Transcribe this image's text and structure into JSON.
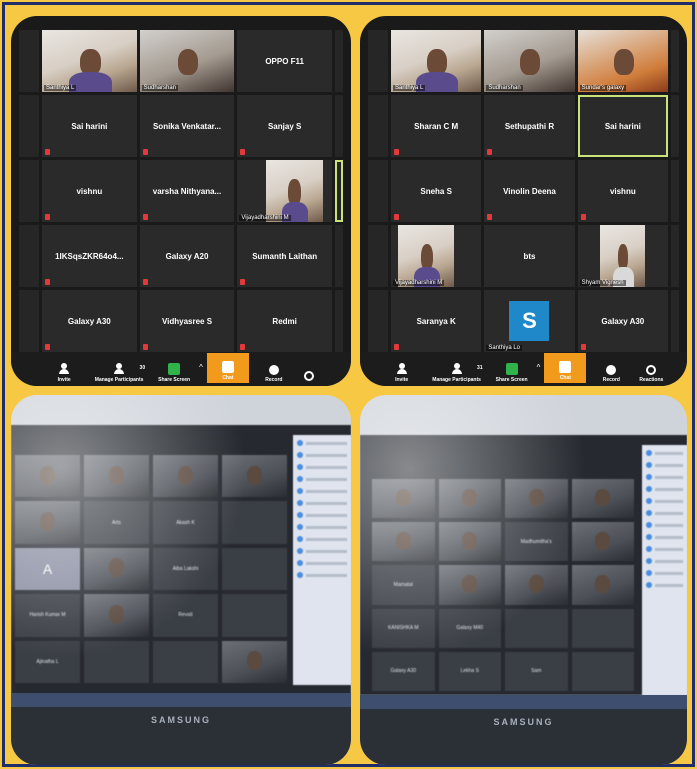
{
  "colors": {
    "background": "#f7c843",
    "border": "#1f2d6b",
    "chat_button": "#f29a1c",
    "share_button": "#2fb34a",
    "active_tile": "#c9e27a",
    "avatar_tile": "#1e88c8"
  },
  "panel1": {
    "tiles": [
      {
        "label": "",
        "video": true,
        "caption": "Santhiya L"
      },
      {
        "label": "",
        "video": true,
        "caption": "Sudharshan"
      },
      {
        "label": "OPPO F11"
      },
      {
        "label": "Sai harini"
      },
      {
        "label": "Sonika Venkatar..."
      },
      {
        "label": "Sanjay S"
      },
      {
        "label": "vishnu"
      },
      {
        "label": "varsha Nithyana..."
      },
      {
        "label": "",
        "video": true,
        "caption": "Vijayadharshini M"
      },
      {
        "label": "1IKSqsZKR64o4..."
      },
      {
        "label": "Galaxy A20"
      },
      {
        "label": "Sumanth Laithan"
      },
      {
        "label": "Galaxy A30"
      },
      {
        "label": "Vidhyasree S"
      },
      {
        "label": "Redmi"
      }
    ],
    "toolbar": {
      "invite": "Invite",
      "participants": "Manage Participants",
      "participants_count": "30",
      "share": "Share Screen",
      "chat": "Chat",
      "record": "Record",
      "reactions": "Reactions"
    }
  },
  "panel2": {
    "tiles": [
      {
        "label": "",
        "video": true,
        "caption": "Santhiya L"
      },
      {
        "label": "",
        "video": true,
        "caption": "Sudharshan"
      },
      {
        "label": "",
        "video": true,
        "caption": "Sundar's galaxy"
      },
      {
        "label": "Sharan C M"
      },
      {
        "label": "Sethupathi R"
      },
      {
        "label": "Sai harini"
      },
      {
        "label": "Sneha S"
      },
      {
        "label": "Vinolin Deena"
      },
      {
        "label": "vishnu"
      },
      {
        "label": "",
        "video": true,
        "caption": "Vijayadharshini M"
      },
      {
        "label": "bts"
      },
      {
        "label": "",
        "video": true,
        "caption": "Shyam Vignesh"
      },
      {
        "label": "Saranya K"
      },
      {
        "label": "S",
        "avatar": true,
        "caption": "Santhiya Lo"
      },
      {
        "label": "Galaxy A30"
      }
    ],
    "toolbar": {
      "invite": "Invite",
      "participants": "Manage Participants",
      "participants_count": "31",
      "share": "Share Screen",
      "chat": "Chat",
      "record": "Record",
      "reactions": "Reactions"
    }
  },
  "panel3": {
    "tiles": [
      {
        "label": "",
        "video": true
      },
      {
        "label": "",
        "video": true
      },
      {
        "label": "",
        "video": true
      },
      {
        "label": "",
        "video": true
      },
      {
        "label": "",
        "video": true
      },
      {
        "label": "Arts"
      },
      {
        "label": "Akash K"
      },
      {
        "label": ""
      },
      {
        "label": "A",
        "avatar": true
      },
      {
        "label": "",
        "video": true
      },
      {
        "label": "Aiba Lakshi"
      },
      {
        "label": ""
      },
      {
        "label": "Harish Kumar M"
      },
      {
        "label": "",
        "video": true
      },
      {
        "label": "Revati"
      },
      {
        "label": ""
      },
      {
        "label": "Ajinatha L"
      },
      {
        "label": ""
      },
      {
        "label": ""
      },
      {
        "label": "",
        "video": true
      }
    ],
    "brand": "SAMSUNG"
  },
  "panel4": {
    "tiles": [
      {
        "label": "",
        "video": true
      },
      {
        "label": "",
        "video": true
      },
      {
        "label": "",
        "video": true
      },
      {
        "label": "",
        "video": true
      },
      {
        "label": "",
        "video": true
      },
      {
        "label": "",
        "video": true
      },
      {
        "label": "Madhumitha's"
      },
      {
        "label": "",
        "video": true
      },
      {
        "label": "Mamatal"
      },
      {
        "label": "",
        "video": true
      },
      {
        "label": "",
        "video": true
      },
      {
        "label": "",
        "video": true
      },
      {
        "label": "KANISHKA M"
      },
      {
        "label": "Galaxy M40"
      },
      {
        "label": ""
      },
      {
        "label": ""
      },
      {
        "label": "Galaxy A30"
      },
      {
        "label": "Lekha S"
      },
      {
        "label": "Sam"
      },
      {
        "label": ""
      }
    ],
    "brand": "SAMSUNG"
  }
}
